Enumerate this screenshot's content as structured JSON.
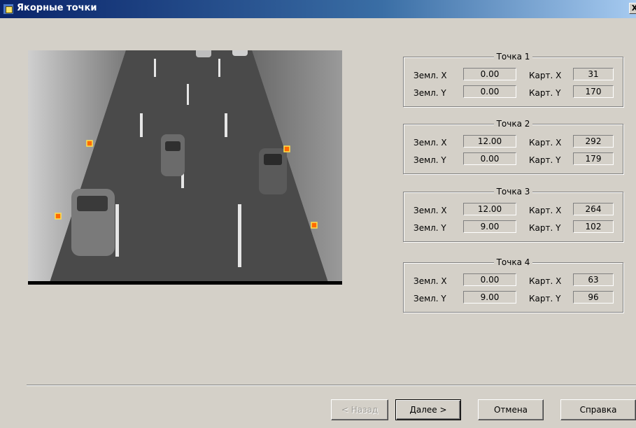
{
  "window": {
    "title": "Якорные точки",
    "close_label": "X"
  },
  "labels": {
    "earth_x": "Земл. X",
    "earth_y": "Земл. Y",
    "map_x": "Карт. X",
    "map_y": "Карт. Y"
  },
  "points": [
    {
      "title": "Точка 1",
      "earth_x": "0.00",
      "earth_y": "0.00",
      "map_x": "31",
      "map_y": "170"
    },
    {
      "title": "Точка 2",
      "earth_x": "12.00",
      "earth_y": "0.00",
      "map_x": "292",
      "map_y": "179"
    },
    {
      "title": "Точка 3",
      "earth_x": "12.00",
      "earth_y": "9.00",
      "map_x": "264",
      "map_y": "102"
    },
    {
      "title": "Точка 4",
      "earth_x": "0.00",
      "earth_y": "9.00",
      "map_x": "63",
      "map_y": "96"
    }
  ],
  "buttons": {
    "back": "< Назад",
    "next": "Далее >",
    "cancel": "Отмена",
    "help": "Справка"
  },
  "colors": {
    "marker": "#ff6a00",
    "marker_border": "#ffe14d",
    "title_bar": "#0a246a"
  }
}
